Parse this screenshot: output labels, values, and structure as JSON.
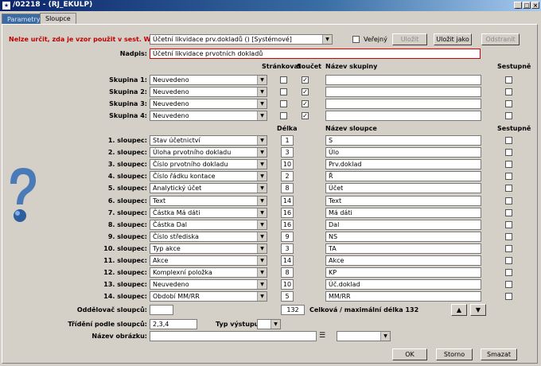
{
  "window": {
    "icon": "★",
    "title": "/02218 - (RJ_EKULP)"
  },
  "tabs": [
    {
      "label": "Parametry"
    },
    {
      "label": "Sloupce"
    }
  ],
  "form": {
    "warning_label": "Nelze určit, zda je vzor použit v sest. WM.",
    "template_value": "Účetní likvidace prv.dokladů   ()   [Systémové]",
    "public_label": "Veřejný",
    "save_label": "Uložit",
    "save_as_label": "Uložit jako",
    "delete_label": "Odstranit",
    "heading_label": "Nadpis:",
    "heading_value": "Účetní likvidace prvotních dokladů"
  },
  "groups": {
    "headers": {
      "paging": "Stránkovat",
      "sum": "Součet",
      "name": "Název skupiny",
      "desc": "Sestupně"
    },
    "rows": [
      {
        "label": "Skupina 1:",
        "value": "Neuvedeno",
        "paging": false,
        "sum": true,
        "name": "",
        "desc": false
      },
      {
        "label": "Skupina 2:",
        "value": "Neuvedeno",
        "paging": false,
        "sum": true,
        "name": "",
        "desc": false
      },
      {
        "label": "Skupina 3:",
        "value": "Neuvedeno",
        "paging": false,
        "sum": true,
        "name": "",
        "desc": false
      },
      {
        "label": "Skupina 4:",
        "value": "Neuvedeno",
        "paging": false,
        "sum": true,
        "name": "",
        "desc": false
      }
    ]
  },
  "columns": {
    "headers": {
      "length": "Délka",
      "name": "Název sloupce",
      "desc": "Sestupně"
    },
    "rows": [
      {
        "label": "1. sloupec:",
        "value": "Stav účetnictví",
        "length": "1",
        "name": "S",
        "desc": false
      },
      {
        "label": "2. sloupec:",
        "value": "Úloha prvotního dokladu",
        "length": "3",
        "name": "Úlo",
        "desc": false
      },
      {
        "label": "3. sloupec:",
        "value": "Číslo prvotního dokladu",
        "length": "10",
        "name": "Prv.doklad",
        "desc": false
      },
      {
        "label": "4. sloupec:",
        "value": "Číslo řádku kontace",
        "length": "2",
        "name": "Ř",
        "desc": false
      },
      {
        "label": "5. sloupec:",
        "value": "Analytický účet",
        "length": "8",
        "name": "Účet",
        "desc": false
      },
      {
        "label": "6. sloupec:",
        "value": "Text",
        "length": "14",
        "name": "Text",
        "desc": false
      },
      {
        "label": "7. sloupec:",
        "value": "Částka Má dáti",
        "length": "16",
        "name": "Má dáti",
        "desc": false
      },
      {
        "label": "8. sloupec:",
        "value": "Částka Dal",
        "length": "16",
        "name": "Dal",
        "desc": false
      },
      {
        "label": "9. sloupec:",
        "value": "Číslo střediska",
        "length": "9",
        "name": "NS",
        "desc": false
      },
      {
        "label": "10. sloupec:",
        "value": "Typ akce",
        "length": "3",
        "name": "TA",
        "desc": false
      },
      {
        "label": "11. sloupec:",
        "value": "Akce",
        "length": "14",
        "name": "Akce",
        "desc": false
      },
      {
        "label": "12. sloupec:",
        "value": "Komplexní položka",
        "length": "8",
        "name": "KP",
        "desc": false
      },
      {
        "label": "13. sloupec:",
        "value": "Neuvedeno",
        "length": "10",
        "name": "Úč.doklad",
        "desc": false
      },
      {
        "label": "14. sloupec:",
        "value": "Období MM/RR",
        "length": "5",
        "name": "MM/RR",
        "desc": false
      }
    ]
  },
  "footer": {
    "separator_label": "Oddělovač sloupců:",
    "separator_value": "",
    "total_length": "132",
    "total_label": "Celková / maximální délka 132",
    "sort_label": "Třídění podle sloupců:",
    "sort_value": "2,3,4",
    "output_type_label": "Typ výstupu:",
    "output_type_value": "",
    "image_label": "Název obrázku:",
    "image_value": "",
    "image_combo_value": "",
    "ok_label": "OK",
    "cancel_label": "Storno",
    "clear_label": "Smazat"
  },
  "colors": {
    "background": "#d4d0c8",
    "warning": "#c00000",
    "titlebar": "#0a246a",
    "active_tab": "#d4d0c8",
    "inactive_tab": "#3b6ba2"
  }
}
